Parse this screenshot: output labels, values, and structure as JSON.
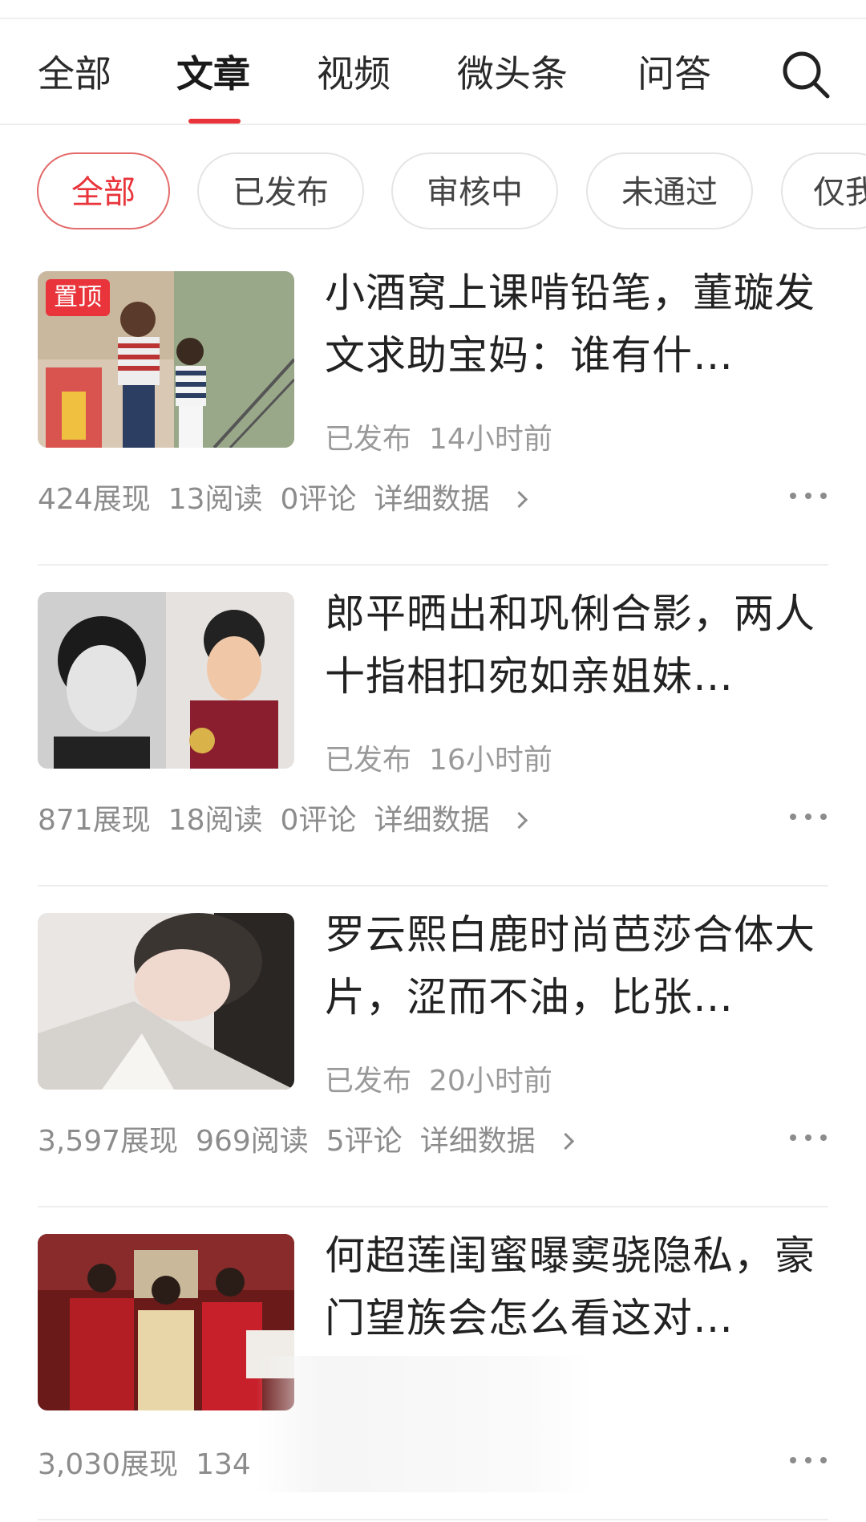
{
  "tabs": [
    {
      "label": "全部",
      "active": false
    },
    {
      "label": "文章",
      "active": true
    },
    {
      "label": "视频",
      "active": false
    },
    {
      "label": "微头条",
      "active": false
    },
    {
      "label": "问答",
      "active": false
    }
  ],
  "search": {
    "icon": "search-icon"
  },
  "filters": [
    {
      "label": "全部",
      "active": true
    },
    {
      "label": "已发布",
      "active": false
    },
    {
      "label": "审核中",
      "active": false
    },
    {
      "label": "未通过",
      "active": false
    },
    {
      "label": "仅我",
      "active": false
    }
  ],
  "accent_color": "#e8343a",
  "articles": [
    {
      "pinned_label": "置顶",
      "title": "小酒窝上课啃铅笔，董璇发文求助宝妈：谁有什…",
      "status": "已发布",
      "time": "14小时前",
      "impressions": "424展现",
      "reads": "13阅读",
      "comments": "0评论",
      "details": "详细数据"
    },
    {
      "title": "郎平晒出和巩俐合影，两人十指相扣宛如亲姐妹…",
      "status": "已发布",
      "time": "16小时前",
      "impressions": "871展现",
      "reads": "18阅读",
      "comments": "0评论",
      "details": "详细数据"
    },
    {
      "title": "罗云熙白鹿时尚芭莎合体大片，涩而不油，比张…",
      "status": "已发布",
      "time": "20小时前",
      "impressions": "3,597展现",
      "reads": "969阅读",
      "comments": "5评论",
      "details": "详细数据"
    },
    {
      "title": "何超莲闺蜜曝窦骁隐私，豪门望族会怎么看这对…",
      "impressions": "3,030展现",
      "reads": "134"
    }
  ]
}
